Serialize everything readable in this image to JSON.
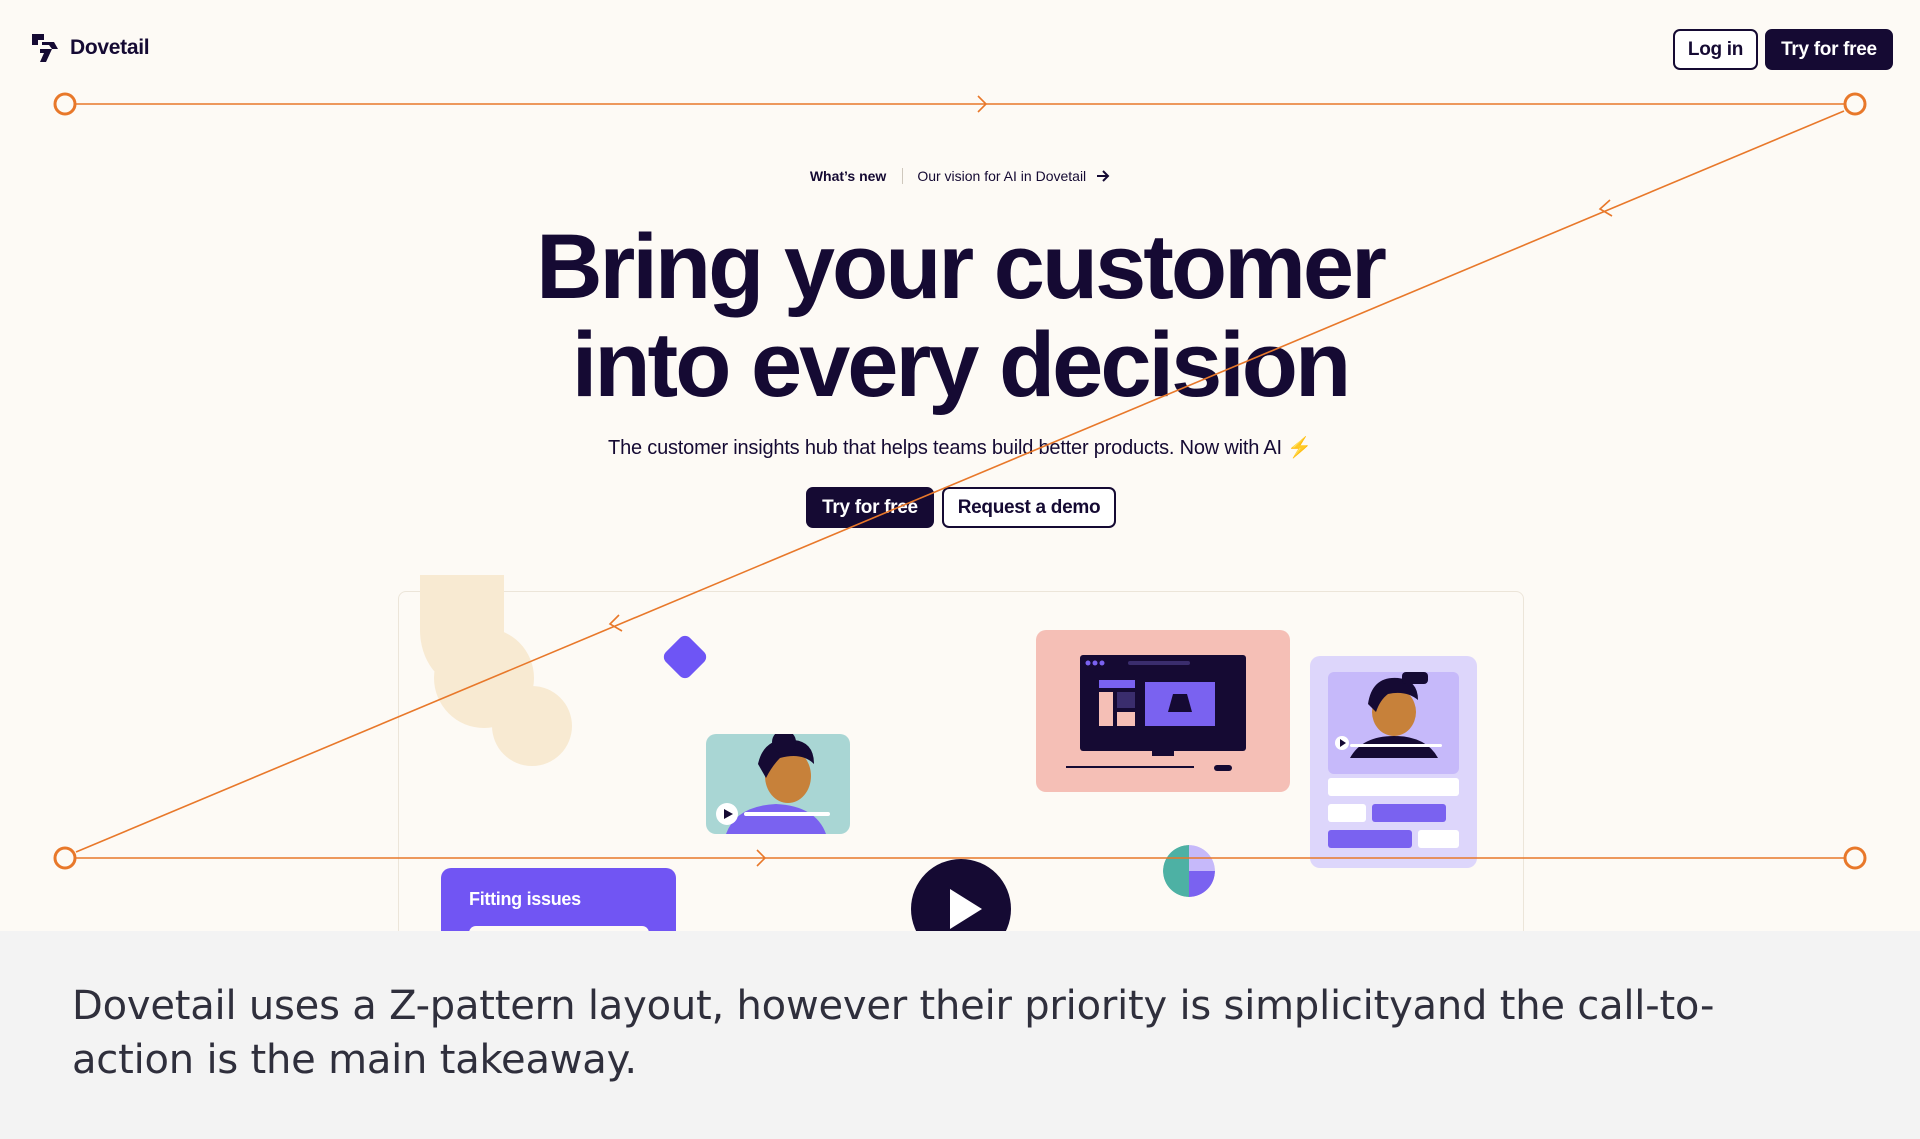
{
  "header": {
    "brand": "Dovetail",
    "login_label": "Log in",
    "try_label": "Try for free"
  },
  "announcement": {
    "tag": "What’s new",
    "link": "Our vision for AI in Dovetail"
  },
  "hero": {
    "title_line1": "Bring your customer",
    "title_line2": "into every decision",
    "subtitle": "The customer insights hub that helps teams build better products. Now with AI",
    "subtitle_icon": "⚡",
    "primary_cta": "Try for free",
    "secondary_cta": "Request a demo"
  },
  "illustration": {
    "card_label": "Fitting issues"
  },
  "caption": "Dovetail uses a Z-pattern layout, however their priority is simplicityand the call-to-action is the main takeaway.",
  "colors": {
    "brand_dark": "#150a33",
    "page_bg": "#fdfaf5",
    "accent_purple": "#6e55f5",
    "annotation_orange": "#e8782a",
    "caption_bg": "#f3f3f3"
  },
  "icons": [
    "dovetail-logo-icon",
    "arrow-right-icon",
    "play-icon",
    "lightning-icon"
  ]
}
